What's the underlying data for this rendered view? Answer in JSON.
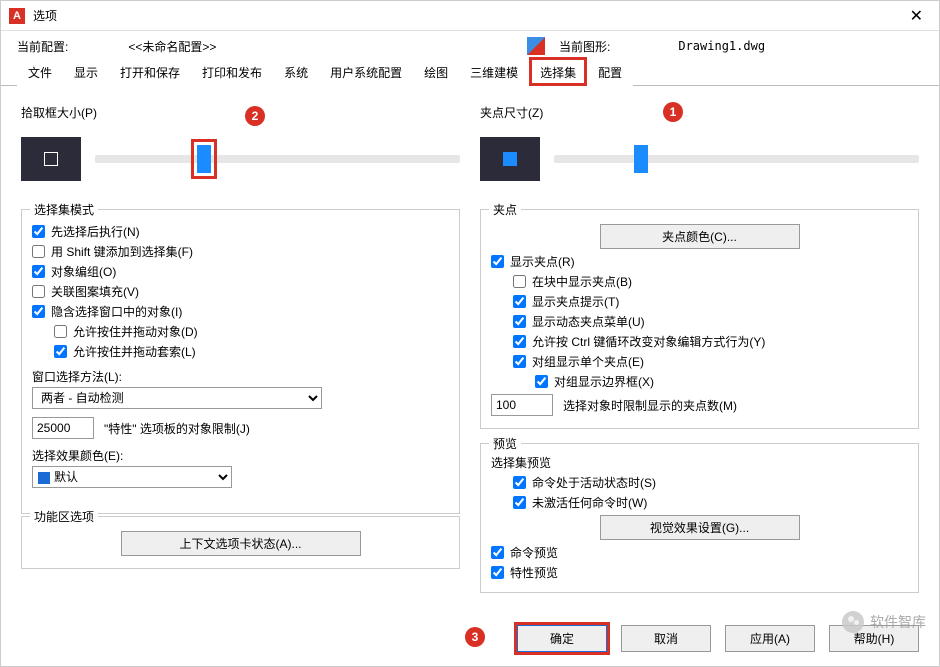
{
  "window": {
    "title": "选项",
    "close_glyph": "✕"
  },
  "profile": {
    "label": "当前配置:",
    "value": "<<未命名配置>>",
    "drawing_label": "当前图形:",
    "drawing_value": "Drawing1.dwg"
  },
  "tabs": [
    "文件",
    "显示",
    "打开和保存",
    "打印和发布",
    "系统",
    "用户系统配置",
    "绘图",
    "三维建模",
    "选择集",
    "配置"
  ],
  "active_tab_index": 8,
  "left": {
    "pickbox_label": "拾取框大小(P)",
    "mode_legend": "选择集模式",
    "modes": {
      "sel_after": "先选择后执行(N)",
      "shift_add": "用 Shift 键添加到选择集(F)",
      "obj_group": "对象编组(O)",
      "assoc_hatch": "关联图案填充(V)",
      "implied_window": "隐含选择窗口中的对象(I)",
      "allow_drag_obj": "允许按住并拖动对象(D)",
      "allow_drag_lasso": "允许按住并拖动套索(L)"
    },
    "window_method_label": "窗口选择方法(L):",
    "window_method_value": "两者 - 自动检测",
    "prop_limit_value": "25000",
    "prop_limit_label": "\"特性\" 选项板的对象限制(J)",
    "effect_color_label": "选择效果颜色(E):",
    "effect_color_value": "默认",
    "ribbon_legend": "功能区选项",
    "ribbon_btn": "上下文选项卡状态(A)..."
  },
  "right": {
    "grip_size_label": "夹点尺寸(Z)",
    "grips_legend": "夹点",
    "grip_color_btn": "夹点颜色(C)...",
    "show_grips": "显示夹点(R)",
    "show_in_block": "在块中显示夹点(B)",
    "show_tips": "显示夹点提示(T)",
    "show_dyn_menu": "显示动态夹点菜单(U)",
    "ctrl_cycle": "允许按 Ctrl 键循环改变对象编辑方式行为(Y)",
    "group_single": "对组显示单个夹点(E)",
    "group_bbox": "对组显示边界框(X)",
    "grip_limit_value": "100",
    "grip_limit_label": "选择对象时限制显示的夹点数(M)",
    "preview_legend": "预览",
    "sel_preview_label": "选择集预览",
    "cmd_active": "命令处于活动状态时(S)",
    "no_cmd_active": "未激活任何命令时(W)",
    "visual_btn": "视觉效果设置(G)...",
    "cmd_preview": "命令预览",
    "prop_preview": "特性预览"
  },
  "footer": {
    "ok": "确定",
    "cancel": "取消",
    "apply": "应用(A)",
    "help": "帮助(H)"
  },
  "watermark": "软件智库",
  "badges": {
    "b1": "1",
    "b2": "2",
    "b3": "3"
  }
}
